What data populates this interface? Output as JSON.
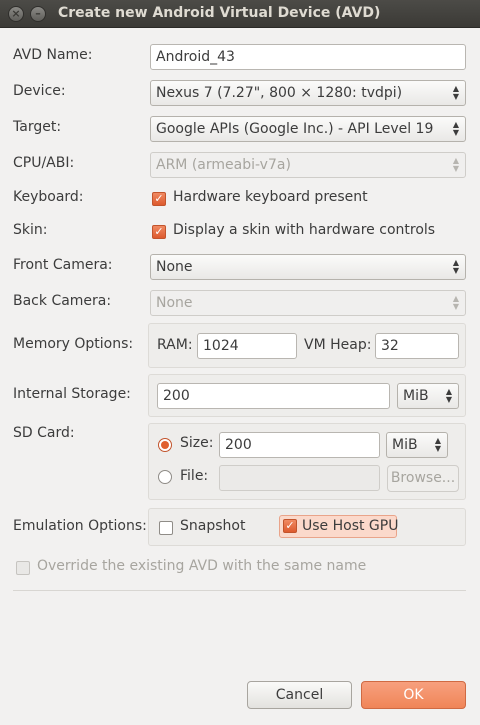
{
  "window": {
    "title": "Create new Android Virtual Device (AVD)"
  },
  "labels": {
    "avd_name": "AVD Name:",
    "device": "Device:",
    "target": "Target:",
    "cpu_abi": "CPU/ABI:",
    "keyboard": "Keyboard:",
    "skin": "Skin:",
    "front_camera": "Front Camera:",
    "back_camera": "Back Camera:",
    "memory_options": "Memory Options:",
    "internal_storage": "Internal Storage:",
    "sd_card": "SD Card:",
    "emulation_options": "Emulation Options:"
  },
  "fields": {
    "avd_name": "Android_43",
    "device": "Nexus 7 (7.27\", 800 × 1280: tvdpi)",
    "target": "Google APIs (Google Inc.) - API Level 19",
    "cpu_abi": "ARM (armeabi-v7a)",
    "front_camera": "None",
    "back_camera": "None",
    "ram_label": "RAM:",
    "ram": "1024",
    "vm_heap_label": "VM Heap:",
    "vm_heap": "32",
    "internal_storage": "200",
    "internal_storage_unit": "MiB",
    "sd_size_label": "Size:",
    "sd_size": "200",
    "sd_size_unit": "MiB",
    "sd_file_label": "File:",
    "sd_file": "",
    "browse": "Browse..."
  },
  "checkboxes": {
    "keyboard": {
      "label": "Hardware keyboard present",
      "checked": true
    },
    "skin": {
      "label": "Display a skin with hardware controls",
      "checked": true
    },
    "snapshot": {
      "label": "Snapshot",
      "checked": false
    },
    "host_gpu": {
      "label": "Use Host GPU",
      "checked": true
    },
    "override": {
      "label": "Override the existing AVD with the same name",
      "checked": false,
      "disabled": true
    }
  },
  "buttons": {
    "cancel": "Cancel",
    "ok": "OK"
  },
  "colors": {
    "accent": "#f08558",
    "checkbox_checked": "#dd5a2e",
    "titlebar": "#3b3a36"
  }
}
